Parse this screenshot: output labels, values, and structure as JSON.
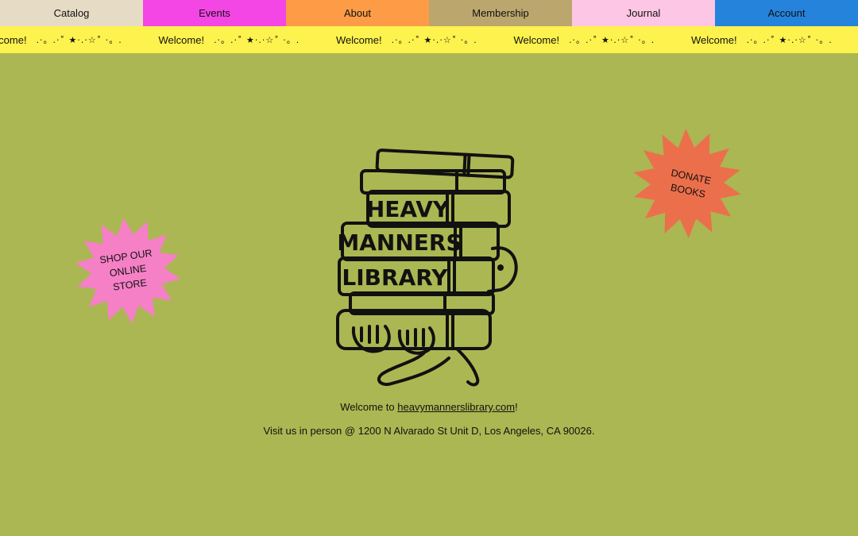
{
  "nav": {
    "items": [
      {
        "label": "Catalog",
        "color": "#e6dbc4"
      },
      {
        "label": "Events",
        "color": "#f446e5"
      },
      {
        "label": "About",
        "color": "#fd9b47"
      },
      {
        "label": "Membership",
        "color": "#bba66e"
      },
      {
        "label": "Journal",
        "color": "#fec6e5"
      },
      {
        "label": "Account",
        "color": "#2583dc"
      }
    ]
  },
  "marquee": {
    "text": "Welcome!",
    "stars": ".·。.·˚ ★·.·☆˚ ·。."
  },
  "shop_burst": {
    "label": "SHOP OUR\nONLINE\nSTORE",
    "color": "#f580c6"
  },
  "donate_burst": {
    "label": "DONATE\nBOOKS",
    "color": "#ec6f4c"
  },
  "logo": {
    "line1": "HEAVY",
    "line2": "MANNERS",
    "line3": "LIBRARY"
  },
  "welcome": {
    "prefix": "Welcome to ",
    "link": "heavymannerslibrary.com",
    "suffix": "!"
  },
  "address": "Visit us in person @ 1200 N Alvarado St Unit D, Los Angeles, CA 90026.",
  "colors": {
    "background": "#abb752",
    "marquee_bg": "#fdf24e"
  }
}
